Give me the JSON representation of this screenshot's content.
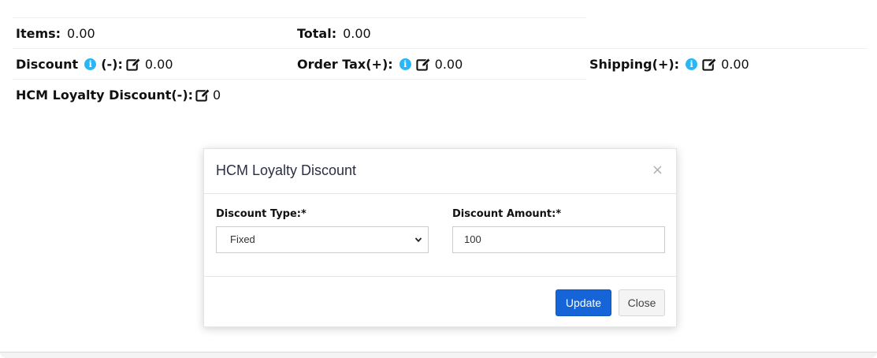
{
  "summary": {
    "items_label": "Items:",
    "items_value": "0.00",
    "total_label": "Total:",
    "total_value": "0.00",
    "discount_label": "Discount",
    "discount_sign": "(-):",
    "discount_value": "0.00",
    "order_tax_label": "Order Tax(+):",
    "order_tax_value": "0.00",
    "shipping_label": "Shipping(+):",
    "shipping_value": "0.00",
    "loyalty_label": "HCM Loyalty Discount(-):",
    "loyalty_value": "0"
  },
  "modal": {
    "title": "HCM Loyalty Discount",
    "close_glyph": "×",
    "discount_type_label": "Discount Type:*",
    "discount_type_value": "Fixed",
    "discount_amount_label": "Discount Amount:*",
    "discount_amount_value": "100",
    "update_label": "Update",
    "close_label": "Close"
  },
  "icons": {
    "info": "info-icon",
    "edit": "edit-icon"
  },
  "colors": {
    "accent": "#1565d8",
    "info": "#29b6f6"
  }
}
